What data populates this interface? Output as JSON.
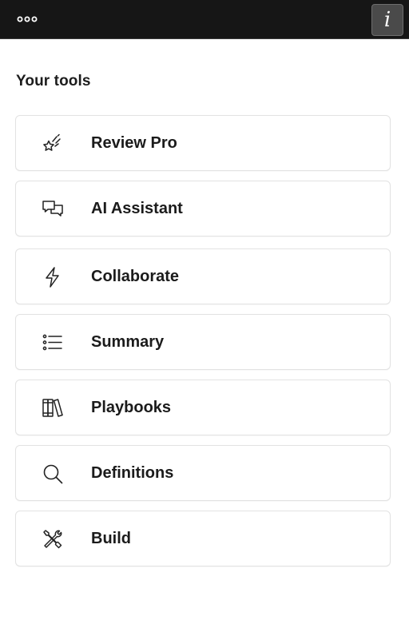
{
  "topbar": {
    "menu_icon": "more-dots-icon",
    "info_label": "i"
  },
  "section": {
    "title": "Your tools"
  },
  "tools": [
    {
      "label": "Review Pro",
      "icon": "sparkle-star-icon"
    },
    {
      "label": "AI Assistant",
      "icon": "chat-bubbles-icon"
    },
    {
      "label": "Collaborate",
      "icon": "lightning-icon"
    },
    {
      "label": "Summary",
      "icon": "list-icon"
    },
    {
      "label": "Playbooks",
      "icon": "books-icon"
    },
    {
      "label": "Definitions",
      "icon": "search-icon"
    },
    {
      "label": "Build",
      "icon": "tools-icon"
    }
  ]
}
